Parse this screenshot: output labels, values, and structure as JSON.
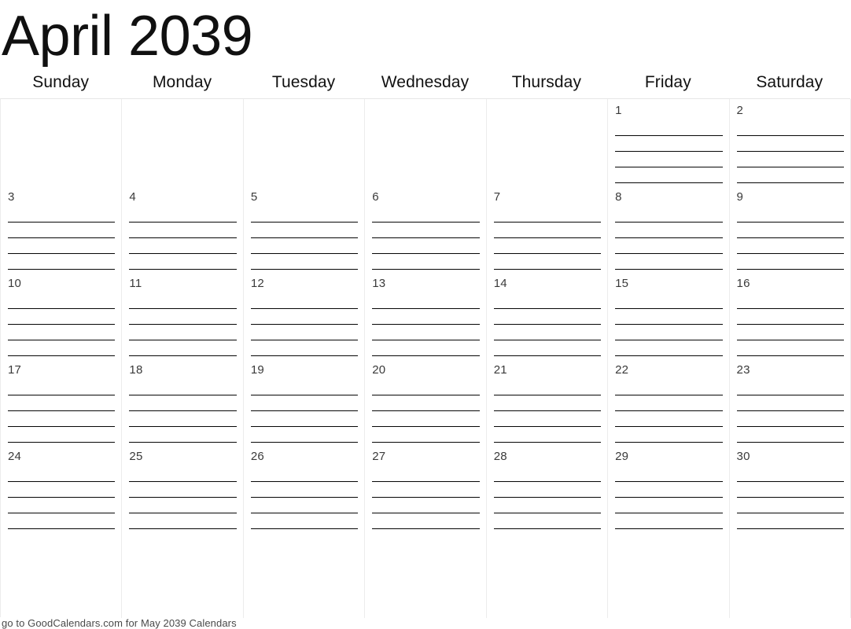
{
  "title": "April 2039",
  "weekdays": [
    "Sunday",
    "Monday",
    "Tuesday",
    "Wednesday",
    "Thursday",
    "Friday",
    "Saturday"
  ],
  "footer": "go to GoodCalendars.com for May 2039 Calendars",
  "colors": {
    "text": "#101010",
    "day_number": "#3a3a3a",
    "grid_line": "#e6e6e6",
    "rule_line": "#060606",
    "background": "#ffffff"
  },
  "layout": {
    "lines_per_day": 4,
    "columns": 7,
    "rows": 6
  },
  "weeks": [
    {
      "days": [
        {
          "number": "",
          "active": false
        },
        {
          "number": "",
          "active": false
        },
        {
          "number": "",
          "active": false
        },
        {
          "number": "",
          "active": false
        },
        {
          "number": "",
          "active": false
        },
        {
          "number": "1",
          "active": true
        },
        {
          "number": "2",
          "active": true
        }
      ]
    },
    {
      "days": [
        {
          "number": "3",
          "active": true
        },
        {
          "number": "4",
          "active": true
        },
        {
          "number": "5",
          "active": true
        },
        {
          "number": "6",
          "active": true
        },
        {
          "number": "7",
          "active": true
        },
        {
          "number": "8",
          "active": true
        },
        {
          "number": "9",
          "active": true
        }
      ]
    },
    {
      "days": [
        {
          "number": "10",
          "active": true
        },
        {
          "number": "11",
          "active": true
        },
        {
          "number": "12",
          "active": true
        },
        {
          "number": "13",
          "active": true
        },
        {
          "number": "14",
          "active": true
        },
        {
          "number": "15",
          "active": true
        },
        {
          "number": "16",
          "active": true
        }
      ]
    },
    {
      "days": [
        {
          "number": "17",
          "active": true
        },
        {
          "number": "18",
          "active": true
        },
        {
          "number": "19",
          "active": true
        },
        {
          "number": "20",
          "active": true
        },
        {
          "number": "21",
          "active": true
        },
        {
          "number": "22",
          "active": true
        },
        {
          "number": "23",
          "active": true
        }
      ]
    },
    {
      "days": [
        {
          "number": "24",
          "active": true
        },
        {
          "number": "25",
          "active": true
        },
        {
          "number": "26",
          "active": true
        },
        {
          "number": "27",
          "active": true
        },
        {
          "number": "28",
          "active": true
        },
        {
          "number": "29",
          "active": true
        },
        {
          "number": "30",
          "active": true
        }
      ]
    },
    {
      "days": [
        {
          "number": "",
          "active": false
        },
        {
          "number": "",
          "active": false
        },
        {
          "number": "",
          "active": false
        },
        {
          "number": "",
          "active": false
        },
        {
          "number": "",
          "active": false
        },
        {
          "number": "",
          "active": false
        },
        {
          "number": "",
          "active": false
        }
      ]
    }
  ]
}
